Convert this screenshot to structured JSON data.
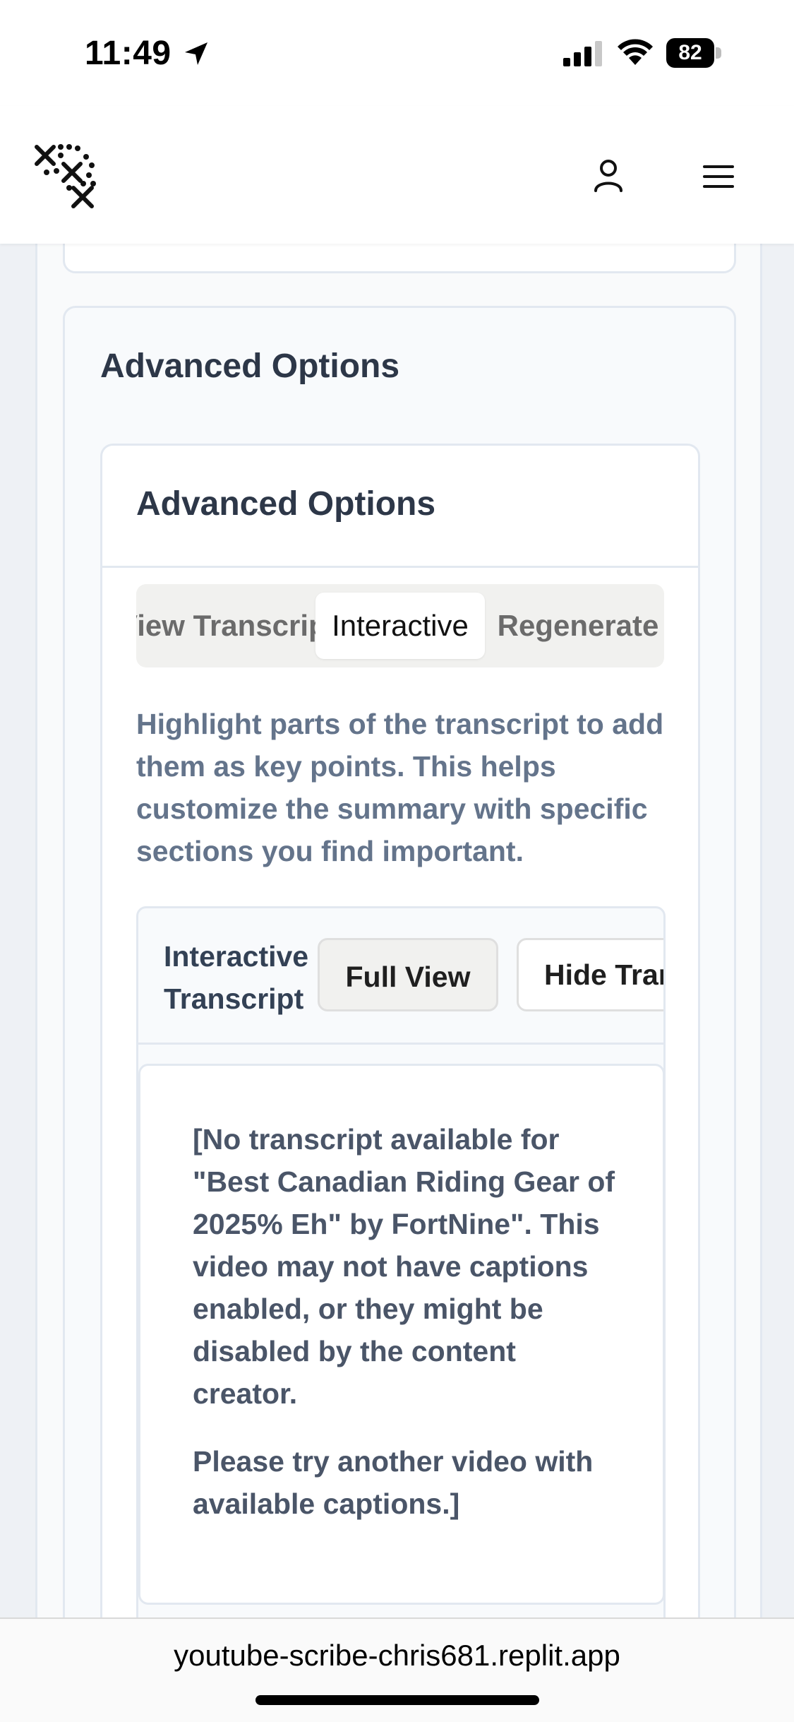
{
  "status_bar": {
    "time": "11:49",
    "battery": "82"
  },
  "header": {
    "logo_icon": "app-logo-icon",
    "user_icon": "user-icon",
    "menu_icon": "hamburger-menu-icon"
  },
  "advanced": {
    "section_title": "Advanced Options",
    "card_title": "Advanced Options",
    "tabs": [
      {
        "label": "View Transcript"
      },
      {
        "label": "Interactive",
        "selected": true
      },
      {
        "label": "Regenerate"
      }
    ],
    "description": "Highlight parts of the transcript to add them as key points. This helps customize the summary with specific sections you find important."
  },
  "transcript": {
    "label": "Interactive Transcript",
    "full_view_label": "Full View",
    "hide_label": "Hide Transcript",
    "paragraph_1": "[No transcript available for \"Best Canadian Riding Gear of 2025% Eh\" by FortNine\". This video may not have captions enabled, or they might be disabled by the content creator.",
    "paragraph_2": "Please try another video with available captions.]"
  },
  "browser": {
    "url": "youtube-scribe-chris681.replit.app"
  },
  "colors": {
    "page_background": "#eef1f5",
    "heading": "#2d3748",
    "muted_text": "#64748b",
    "border": "#e2e8f0"
  }
}
